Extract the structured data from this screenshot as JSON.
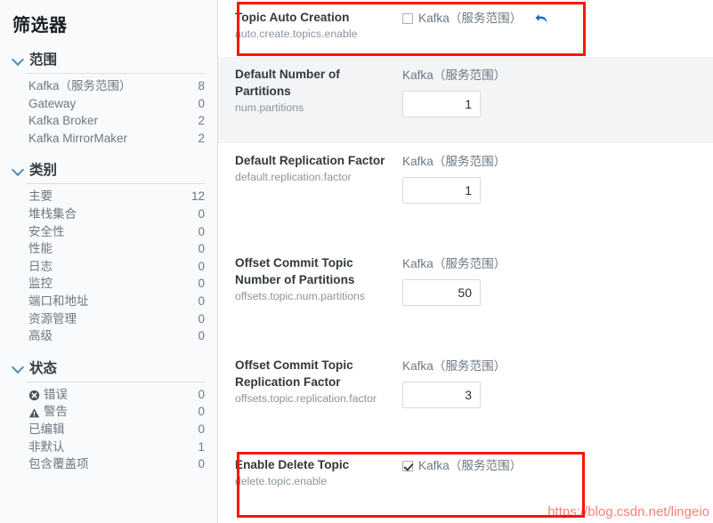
{
  "sidebar": {
    "title": "筛选器",
    "facets": [
      {
        "name": "scope",
        "title": "范围",
        "items": [
          {
            "label": "Kafka（服务范围）",
            "count": "8",
            "icon": ""
          },
          {
            "label": "Gateway",
            "count": "0",
            "icon": ""
          },
          {
            "label": "Kafka Broker",
            "count": "2",
            "icon": ""
          },
          {
            "label": "Kafka MirrorMaker",
            "count": "2",
            "icon": ""
          }
        ]
      },
      {
        "name": "category",
        "title": "类别",
        "items": [
          {
            "label": "主要",
            "count": "12",
            "icon": ""
          },
          {
            "label": "堆栈集合",
            "count": "0",
            "icon": ""
          },
          {
            "label": "安全性",
            "count": "0",
            "icon": ""
          },
          {
            "label": "性能",
            "count": "0",
            "icon": ""
          },
          {
            "label": "日志",
            "count": "0",
            "icon": ""
          },
          {
            "label": "监控",
            "count": "0",
            "icon": ""
          },
          {
            "label": "端口和地址",
            "count": "0",
            "icon": ""
          },
          {
            "label": "资源管理",
            "count": "0",
            "icon": ""
          },
          {
            "label": "高级",
            "count": "0",
            "icon": ""
          }
        ]
      },
      {
        "name": "status",
        "title": "状态",
        "items": [
          {
            "label": "错误",
            "count": "0",
            "icon": "error-icon"
          },
          {
            "label": "警告",
            "count": "0",
            "icon": "warning-icon"
          },
          {
            "label": "已编辑",
            "count": "0",
            "icon": ""
          },
          {
            "label": "非默认",
            "count": "1",
            "icon": ""
          },
          {
            "label": "包含覆盖项",
            "count": "0",
            "icon": ""
          }
        ]
      }
    ]
  },
  "main": {
    "rows": [
      {
        "name": "Topic Auto Creation",
        "key": "auto.create.topics.enable",
        "scope": "Kafka（服务范围）",
        "control": "checkbox",
        "checked": false,
        "undo": "↰",
        "shaded": false,
        "highlighted": true
      },
      {
        "name": "Default Number of Partitions",
        "key": "num.partitions",
        "scope": "Kafka（服务范围）",
        "control": "number",
        "value": "1",
        "shaded": true,
        "highlighted": false
      },
      {
        "name": "Default Replication Factor",
        "key": "default.replication.factor",
        "scope": "Kafka（服务范围）",
        "control": "number",
        "value": "1",
        "shaded": false,
        "highlighted": false
      },
      {
        "name": "Offset Commit Topic Number of Partitions",
        "key": "offsets.topic.num.partitions",
        "scope": "Kafka（服务范围）",
        "control": "number",
        "value": "50",
        "shaded": false,
        "highlighted": false
      },
      {
        "name": "Offset Commit Topic Replication Factor",
        "key": "offsets.topic.replication.factor",
        "scope": "Kafka（服务范围）",
        "control": "number",
        "value": "3",
        "shaded": false,
        "highlighted": false
      },
      {
        "name": "Enable Delete Topic",
        "key": "delete.topic.enable",
        "scope": "Kafka（服务范围）",
        "control": "checkbox",
        "checked": true,
        "shaded": false,
        "highlighted": true
      }
    ]
  },
  "watermark": "https://blog.csdn.net/lingeio",
  "colors": {
    "annotation": "#fb1605",
    "accent": "#4c8eba",
    "shaded_row": "#f2f4f6",
    "sidebar_bg": "#f9fafb"
  }
}
